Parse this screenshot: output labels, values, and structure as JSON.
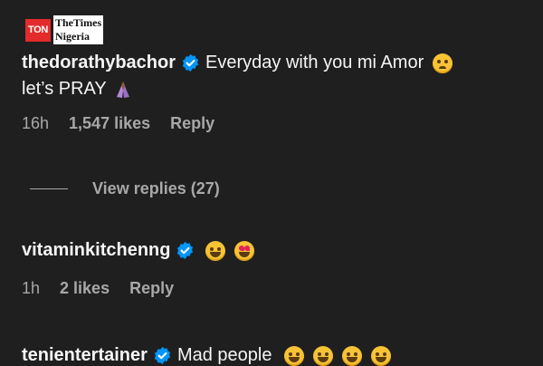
{
  "watermark": {
    "badge": "TON",
    "line1": "TheTimes",
    "line2": "Nigeria"
  },
  "comments": [
    {
      "username": "thedorathybachor",
      "text_line1": "Everyday with you mi Amor",
      "text_line2": "let’s PRAY",
      "time": "16h",
      "likes": "1,547 likes",
      "reply": "Reply"
    },
    {
      "username": "vitaminkitchenng",
      "text_line1": "",
      "time": "1h",
      "likes": "2 likes",
      "reply": "Reply"
    },
    {
      "username": "tenientertainer",
      "text_line1": "Mad people"
    }
  ],
  "view_replies": "View replies (27)",
  "colors": {
    "background": "#1f1f1f",
    "text": "#f5f5f5",
    "muted": "#a8a8a8",
    "verified": "#0095f6"
  },
  "icons": [
    "verified-badge-icon",
    "pleading-face-emoji",
    "praying-hands-emoji",
    "tears-of-joy-emoji",
    "heart-eyes-emoji"
  ]
}
